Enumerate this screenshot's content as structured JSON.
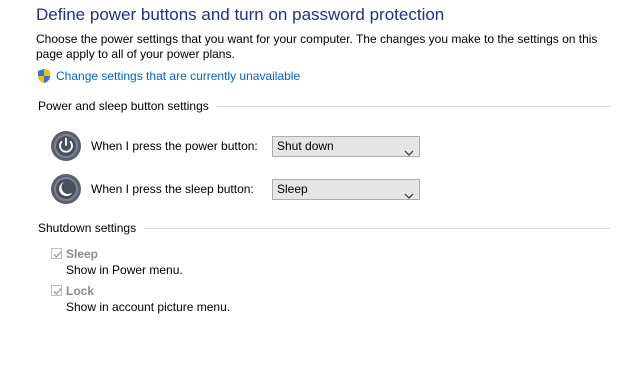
{
  "header": {
    "title": "Define power buttons and turn on password protection",
    "description": "Choose the power settings that you want for your computer. The changes you make to the settings on this page apply to all of your power plans.",
    "change_link": "Change settings that are currently unavailable"
  },
  "power_sleep": {
    "group_label": "Power and sleep button settings",
    "power_button_label": "When I press the power button:",
    "power_button_value": "Shut down",
    "sleep_button_label": "When I press the sleep button:",
    "sleep_button_value": "Sleep"
  },
  "shutdown": {
    "group_label": "Shutdown settings",
    "items": [
      {
        "label": "Sleep",
        "description": "Show in Power menu.",
        "checked": true,
        "disabled": true
      },
      {
        "label": "Lock",
        "description": "Show in account picture menu.",
        "checked": true,
        "disabled": true
      }
    ]
  },
  "icons": {
    "shield": "uac-shield-icon",
    "power": "power-button-icon",
    "sleep": "sleep-moon-icon",
    "chevron": "chevron-down-icon"
  },
  "colors": {
    "title": "#1e3287",
    "link": "#0066cc",
    "disabled_text": "#8c8c8c",
    "select_bg": "#e5e5e5"
  }
}
